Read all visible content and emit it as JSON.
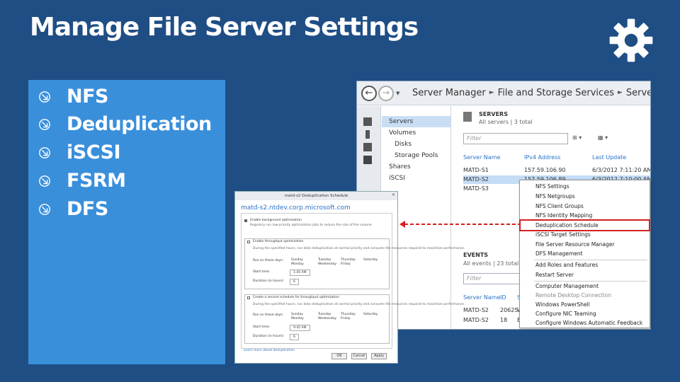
{
  "slide": {
    "title": "Manage File Server Settings",
    "bullets": [
      "NFS",
      "Deduplication",
      "iSCSI",
      "FSRM",
      "DFS"
    ]
  },
  "server_manager": {
    "breadcrumb": [
      "Server Manager",
      "File and Storage Services",
      "Servers"
    ],
    "nav": [
      "Servers",
      "Volumes",
      "Disks",
      "Storage Pools",
      "Shares",
      "iSCSI"
    ],
    "servers_header": "SERVERS",
    "servers_sub": "All servers | 3 total",
    "filter_placeholder": "Filter",
    "columns": [
      "Server Name",
      "IPv4 Address",
      "Last Update"
    ],
    "rows": [
      {
        "name": "MATD-S1",
        "ip": "157.59.106.90",
        "update": "6/3/2012 7:11:20 AM"
      },
      {
        "name": "MATD-S2",
        "ip": "157.59.106.89",
        "update": "6/3/2012 7:10:00 AM"
      },
      {
        "name": "MATD-S3",
        "ip": "",
        "update": ""
      }
    ],
    "events_header": "EVENTS",
    "events_sub": "All events | 23 total",
    "event_columns": [
      "Server Name",
      "ID",
      "Se"
    ],
    "event_rows": [
      {
        "name": "MATD-S2",
        "id": "20625",
        "sev": "W"
      },
      {
        "name": "MATD-S2",
        "id": "18",
        "sev": "Er"
      }
    ]
  },
  "context_menu": {
    "items": [
      "NFS Settings",
      "NFS Netgroups",
      "NFS Client Groups",
      "NFS Identity Mapping",
      "Deduplication Schedule",
      "iSCSI Target Settings",
      "File Server Resource Manager",
      "DFS Management",
      "Add Roles and Features",
      "Restart Server",
      "Computer Management",
      "Remote Desktop Connection",
      "Windows PowerShell",
      "Configure NIC Teaming",
      "Configure Windows Automatic Feedback"
    ],
    "highlighted": "Deduplication Schedule"
  },
  "dialog": {
    "title": "matd-s2 Deduplication Schedule",
    "host": "matd-s2.ntdev.corp.microsoft.com",
    "enable_bg": "Enable background optimization",
    "bg_desc": "Regularly run low-priority optimization jobs to reduce the size of the volume.",
    "enable_tp1": "Enable throughput optimization",
    "tp1_desc": "During the specified hours, run data deduplication at normal priority and consume the resources required to maximize performance.",
    "run_on": "Run on these days:",
    "days1": [
      "Sunday",
      "Monday",
      "Tuesday",
      "Wednesday",
      "Thursday",
      "Friday",
      "Saturday"
    ],
    "start_time": "Start time:",
    "start_val": "1:45 AM",
    "duration": "Duration (in hours):",
    "duration_val": "6",
    "enable_tp2": "Create a second schedule for throughput optimization",
    "tp2_desc": "During the specified hours, run data deduplication at normal priority and consume the resources required to maximize performance.",
    "days2": [
      "Sunday",
      "Monday",
      "Tuesday",
      "Wednesday",
      "Thursday",
      "Friday",
      "Saturday"
    ],
    "start_val2": "9:45 AM",
    "duration_val2": "6",
    "link": "Learn more about deduplication",
    "ok": "OK",
    "cancel": "Cancel",
    "apply": "Apply"
  },
  "colors": {
    "background": "#1f4e85",
    "panel": "#3a8fdb",
    "highlight_box": "#d42020"
  }
}
